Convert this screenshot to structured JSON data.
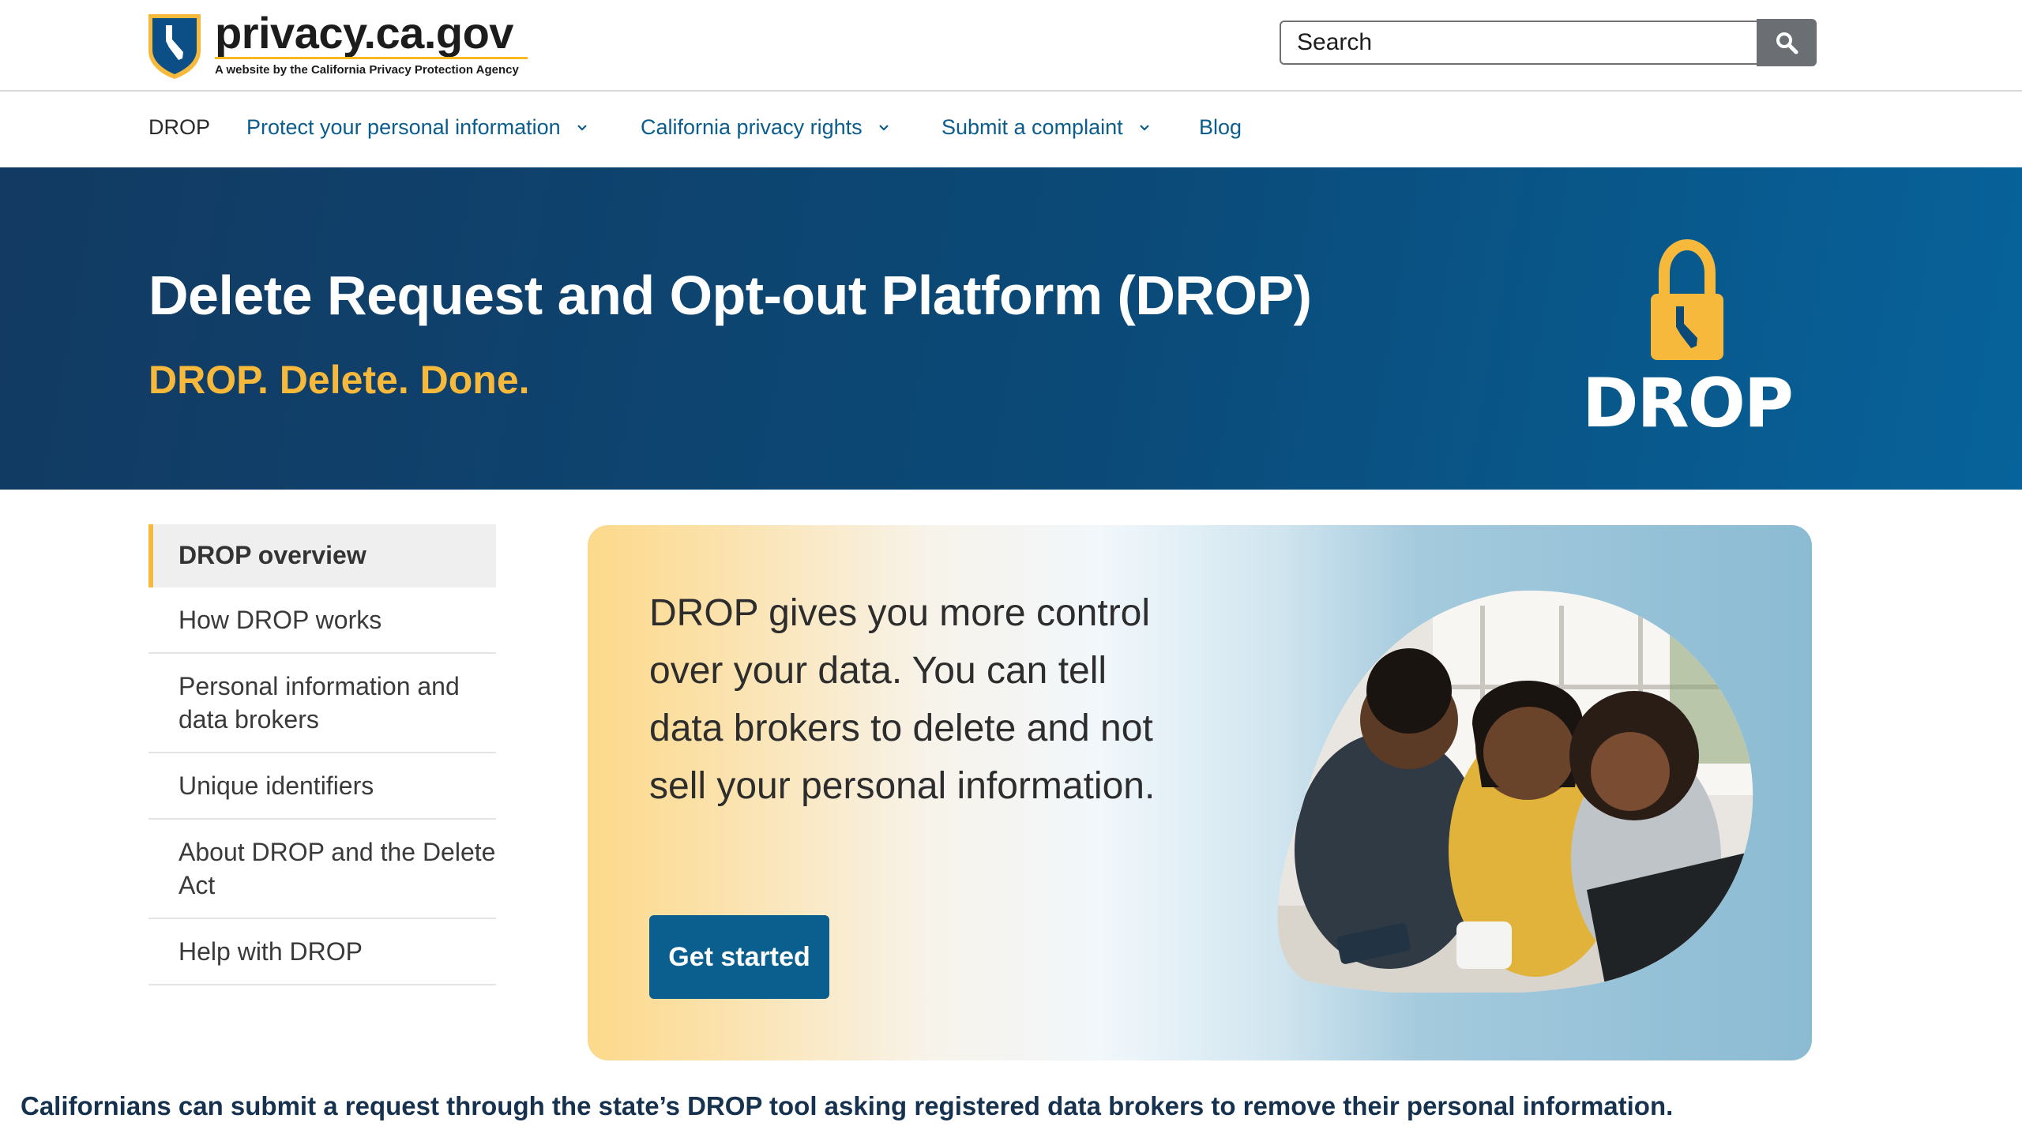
{
  "header": {
    "site_title": "privacy.ca.gov",
    "site_subtitle": "A website by the California Privacy Protection Agency",
    "search_placeholder": "Search",
    "search_button_icon": "search-icon"
  },
  "nav": {
    "items": [
      {
        "label": "DROP",
        "has_dropdown": false
      },
      {
        "label": "Protect your personal information",
        "has_dropdown": true
      },
      {
        "label": "California privacy rights",
        "has_dropdown": true
      },
      {
        "label": "Submit a complaint",
        "has_dropdown": true
      },
      {
        "label": "Blog",
        "has_dropdown": false
      }
    ]
  },
  "hero": {
    "title": "Delete Request and Opt-out Platform (DROP)",
    "tagline": "DROP. Delete. Done.",
    "logo_text": "DROP",
    "logo_icon": "padlock-california-icon"
  },
  "sidebar": {
    "items": [
      {
        "label": "DROP overview",
        "active": true
      },
      {
        "label": "How DROP works",
        "active": false
      },
      {
        "label": "Personal information and data brokers",
        "active": false
      },
      {
        "label": "Unique identifiers",
        "active": false
      },
      {
        "label": "About DROP and the Delete Act",
        "active": false
      },
      {
        "label": "Help with DROP",
        "active": false
      }
    ]
  },
  "feature": {
    "body": "DROP gives you more control over your data. You can tell data brokers to delete and not sell your personal information.",
    "button_label": "Get started"
  },
  "caption": "Californians can submit a request through the state’s DROP tool asking registered data brokers to remove their personal information.",
  "colors": {
    "brand_blue": "#0b5f8e",
    "hero_dark": "#123a62",
    "accent_gold": "#f6b93b",
    "link_blue": "#0a5d8c"
  }
}
